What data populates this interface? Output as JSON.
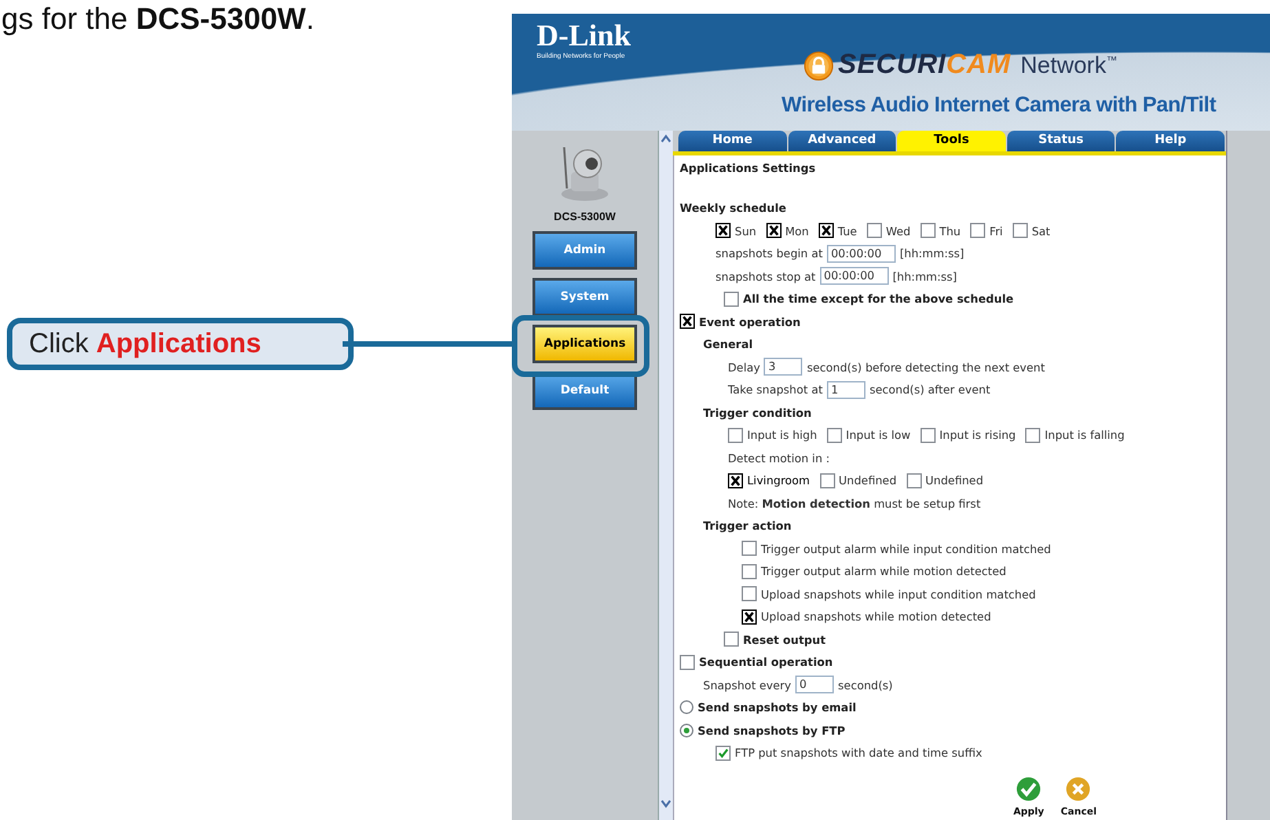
{
  "doc_heading": "gs for the **DCS-5300W**.",
  "callout": "Click **Applications**",
  "app": {
    "brand": {
      "logo": "D-Link",
      "tagline": "Building Networks for People",
      "product_a": "SECURI",
      "product_b": "CAM",
      "product_c": "Network",
      "trademark": "™",
      "subtitle": "Wireless Audio Internet Camera with Pan/Tilt"
    },
    "sidebar": {
      "model": "DCS-5300W",
      "buttons": [
        {
          "label": "Admin",
          "selected": false
        },
        {
          "label": "System",
          "selected": false
        },
        {
          "label": "Applications",
          "selected": true
        },
        {
          "label": "Default",
          "selected": false
        }
      ]
    },
    "tabs": [
      {
        "label": "Home",
        "selected": false
      },
      {
        "label": "Advanced",
        "selected": false
      },
      {
        "label": "Tools",
        "selected": true
      },
      {
        "label": "Status",
        "selected": false
      },
      {
        "label": "Help",
        "selected": false
      }
    ],
    "title": "Applications Settings",
    "weekly_schedule": {
      "title": "Weekly schedule",
      "days": [
        {
          "label": "Sun",
          "checked": true
        },
        {
          "label": "Mon",
          "checked": true
        },
        {
          "label": "Tue",
          "checked": true
        },
        {
          "label": "Wed",
          "checked": false
        },
        {
          "label": "Thu",
          "checked": false
        },
        {
          "label": "Fri",
          "checked": false
        },
        {
          "label": "Sat",
          "checked": false
        }
      ],
      "begin": {
        "label": "snapshots begin at",
        "value": "00:00:00",
        "hint": "[hh:mm:ss]"
      },
      "stop": {
        "label": "snapshots stop at",
        "value": "00:00:00",
        "hint": "[hh:mm:ss]"
      },
      "except": {
        "label": "All the time except for the above schedule",
        "checked": false
      }
    },
    "event_operation": {
      "label": "Event operation",
      "checked": true,
      "general": "General",
      "delay": {
        "label": "Delay",
        "value": "3",
        "suffix": "second(s) before detecting the next event"
      },
      "snapshot": {
        "label": "Take snapshot at",
        "value": "1",
        "suffix": "second(s) after event"
      },
      "trigger_condition": "Trigger condition",
      "inputs": [
        {
          "label": "Input is high",
          "checked": false
        },
        {
          "label": "Input is low",
          "checked": false
        },
        {
          "label": "Input is rising",
          "checked": false
        },
        {
          "label": "Input is falling",
          "checked": false
        }
      ],
      "detect_label": "Detect motion in :",
      "areas": [
        {
          "label": "Livingroom",
          "checked": true
        },
        {
          "label": "Undefined",
          "checked": false
        },
        {
          "label": "Undefined",
          "checked": false
        }
      ],
      "note": "Note: **Motion detection** must be setup first",
      "trigger_action": "Trigger action",
      "actions": [
        {
          "label": "Trigger output alarm while input condition matched",
          "checked": false
        },
        {
          "label": "Trigger output alarm while motion detected",
          "checked": false
        },
        {
          "label": "Upload snapshots while input condition matched",
          "checked": false
        },
        {
          "label": "Upload snapshots while motion detected",
          "checked": true
        }
      ],
      "reset": {
        "label": "Reset output",
        "checked": false
      }
    },
    "sequential": {
      "label": "Sequential operation",
      "checked": false,
      "every": {
        "label": "Snapshot every",
        "value": "0",
        "suffix": "second(s)"
      }
    },
    "delivery": [
      {
        "label": "Send snapshots by email",
        "selected": false
      },
      {
        "label": "Send snapshots by FTP",
        "selected": true
      }
    ],
    "ftp_suffix": {
      "label": "FTP put snapshots with date and time suffix",
      "checked": true
    },
    "buttons": [
      {
        "label": "Apply",
        "kind": "apply"
      },
      {
        "label": "Cancel",
        "kind": "cancel"
      }
    ]
  }
}
